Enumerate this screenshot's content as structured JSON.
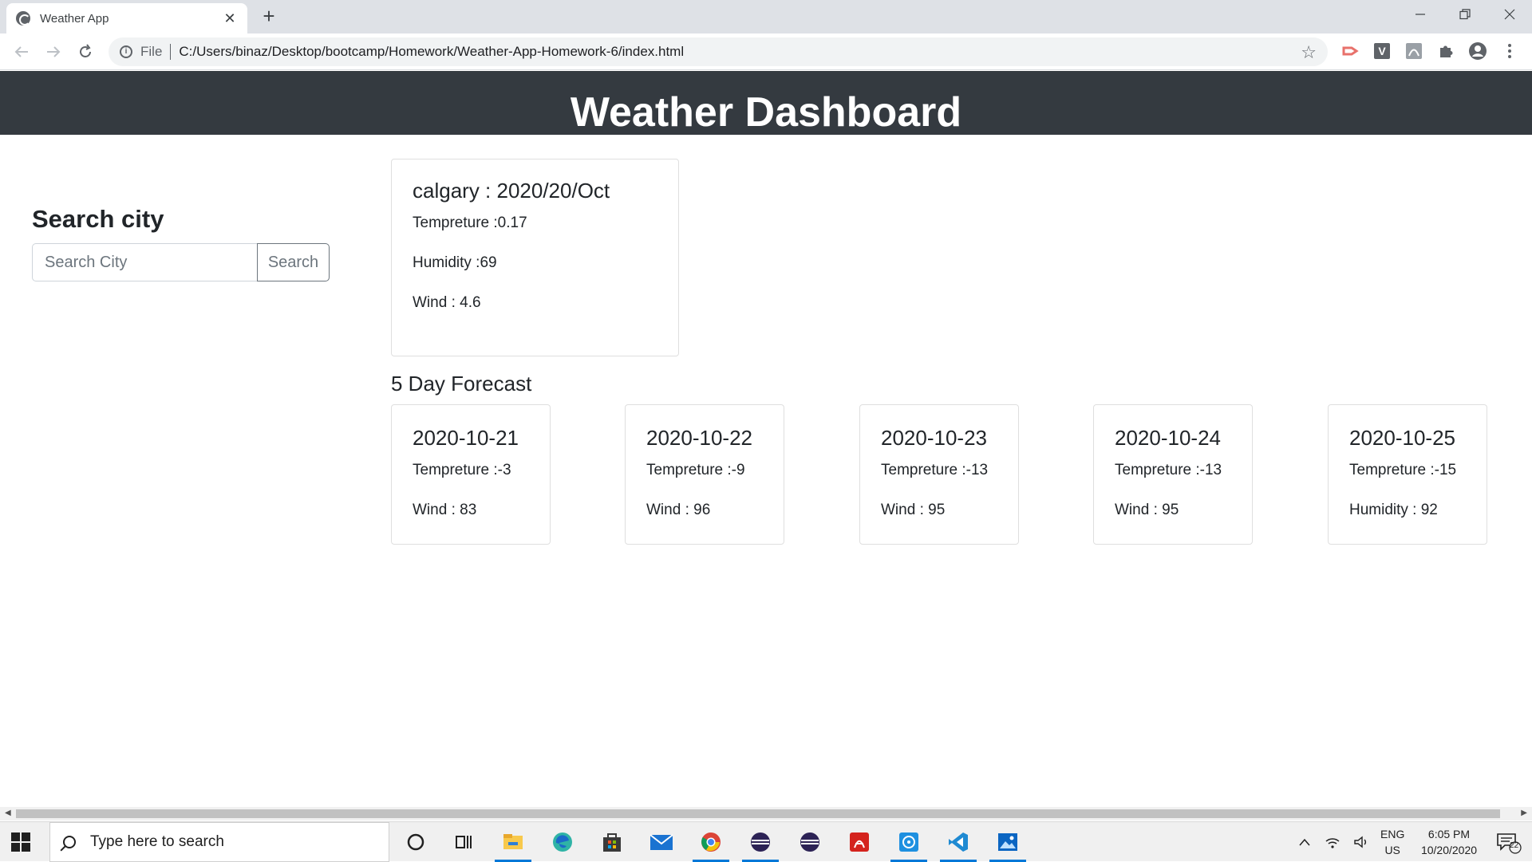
{
  "browser": {
    "tab_title": "Weather App",
    "tab_close": "✕",
    "new_tab": "+",
    "scheme_label": "File",
    "url": "C:/Users/binaz/Desktop/bootcamp/Homework/Weather-App-Homework-6/index.html"
  },
  "page": {
    "title": "Weather Dashboard",
    "search": {
      "heading": "Search city",
      "placeholder": "Search City",
      "button_label": "Search"
    },
    "current": {
      "title": "calgary : 2020/20/Oct",
      "temperature": "Tempreture :0.17",
      "humidity": "Humidity :69",
      "wind": "Wind : 4.6"
    },
    "forecast_heading": "5 Day Forecast",
    "forecast": [
      {
        "date": "2020-10-21",
        "line1": "Tempreture :-3",
        "line2": "Wind : 83"
      },
      {
        "date": "2020-10-22",
        "line1": "Tempreture :-9",
        "line2": "Wind : 96"
      },
      {
        "date": "2020-10-23",
        "line1": "Tempreture :-13",
        "line2": "Wind : 95"
      },
      {
        "date": "2020-10-24",
        "line1": "Tempreture :-13",
        "line2": "Wind : 95"
      },
      {
        "date": "2020-10-25",
        "line1": "Tempreture :-15",
        "line2": "Humidity : 92"
      }
    ]
  },
  "taskbar": {
    "search_placeholder": "Type here to search",
    "lang_top": "ENG",
    "lang_bottom": "US",
    "time": "6:05 PM",
    "date": "10/20/2020",
    "notification_count": "22"
  },
  "colors": {
    "header_bg": "#343a40",
    "taskbar_accent": "#0078d7"
  }
}
